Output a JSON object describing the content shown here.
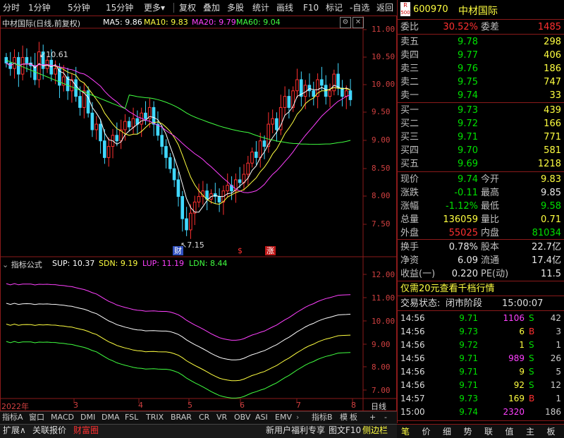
{
  "toolbar": {
    "left_items": [
      "分时",
      "1分钟",
      "5分钟",
      "15分钟",
      "更多"
    ],
    "right_items": [
      "复权",
      "叠加",
      "多股",
      "统计",
      "画线",
      "F10",
      "标记",
      "-自选",
      "返回"
    ]
  },
  "main_chart": {
    "title": "中材国际(日线,前复权)",
    "ma": [
      {
        "label": "MA5: 9.86",
        "color": "#ffffff"
      },
      {
        "label": "MA10: 9.83",
        "color": "#ffff40"
      },
      {
        "label": "MA20: 9.79",
        "color": "#ff40ff"
      },
      {
        "label": "MA60: 9.04",
        "color": "#40ff40"
      }
    ],
    "y_ticks": [
      "11.00",
      "10.50",
      "10.00",
      "9.50",
      "9.00",
      "8.50",
      "8.00",
      "7.50"
    ],
    "high_mark": "10.61",
    "low_mark": "7.15",
    "event_tags": [
      "财",
      "$",
      "涨"
    ]
  },
  "indicator_chart": {
    "name": "指标公式",
    "legend": [
      {
        "label": "SUP: 10.37",
        "color": "#ffffff"
      },
      {
        "label": "SDN: 9.19",
        "color": "#ffff40"
      },
      {
        "label": "LUP: 11.19",
        "color": "#ff40ff"
      },
      {
        "label": "LDN: 8.44",
        "color": "#40ff40"
      }
    ],
    "y_ticks": [
      "12.00",
      "11.00",
      "10.00",
      "9.00",
      "8.00",
      "7.00"
    ]
  },
  "x_axis": {
    "labels": [
      "2022年",
      "3",
      "4",
      "5",
      "6",
      "7",
      "8"
    ],
    "period": "日线"
  },
  "indicator_tabs": [
    "指标A",
    "窗口",
    "MACD",
    "DMI",
    "DMA",
    "FSL",
    "TRIX",
    "BRAR",
    "CR",
    "VR",
    "OBV",
    "ASI",
    "EMV"
  ],
  "indicator_tabs_right": [
    "指标B",
    "模",
    "板",
    "+",
    "-"
  ],
  "status_tabs": [
    "扩展∧",
    "关联报价",
    "财富圈"
  ],
  "status_links": [
    "新用户福利专享",
    "图文F10",
    "侧边栏"
  ],
  "quote": {
    "code": "600970",
    "name": "中材国际",
    "badge_top": "R",
    "badge_bottom": "500",
    "weibi_label": "委比",
    "weibi": "30.52%",
    "weicha_label": "委差",
    "weicha": "1485",
    "asks": [
      {
        "label": "卖五",
        "price": "9.78",
        "vol": "298"
      },
      {
        "label": "卖四",
        "price": "9.77",
        "vol": "406"
      },
      {
        "label": "卖三",
        "price": "9.76",
        "vol": "186"
      },
      {
        "label": "卖二",
        "price": "9.75",
        "vol": "747"
      },
      {
        "label": "卖一",
        "price": "9.74",
        "vol": "33"
      }
    ],
    "bids": [
      {
        "label": "买一",
        "price": "9.73",
        "vol": "439"
      },
      {
        "label": "买二",
        "price": "9.72",
        "vol": "166"
      },
      {
        "label": "买三",
        "price": "9.71",
        "vol": "771"
      },
      {
        "label": "买四",
        "price": "9.70",
        "vol": "581"
      },
      {
        "label": "买五",
        "price": "9.69",
        "vol": "1218"
      }
    ],
    "stats": [
      {
        "l1": "现价",
        "v1": "9.74",
        "c1": "green",
        "l2": "今开",
        "v2": "9.83",
        "c2": "yellow"
      },
      {
        "l1": "涨跌",
        "v1": "-0.11",
        "c1": "green",
        "l2": "最高",
        "v2": "9.85",
        "c2": "white"
      },
      {
        "l1": "涨幅",
        "v1": "-1.12%",
        "c1": "green",
        "l2": "最低",
        "v2": "9.58",
        "c2": "green"
      },
      {
        "l1": "总量",
        "v1": "136059",
        "c1": "yellow",
        "l2": "量比",
        "v2": "0.71",
        "c2": "yellow"
      },
      {
        "l1": "外盘",
        "v1": "55025",
        "c1": "red",
        "l2": "内盘",
        "v2": "81034",
        "c2": "green"
      }
    ],
    "stats2": [
      {
        "l1": "换手",
        "v1": "0.78%",
        "l2": "股本",
        "v2": "22.7亿"
      },
      {
        "l1": "净资",
        "v1": "6.09",
        "l2": "流通",
        "v2": "17.4亿"
      },
      {
        "l1": "收益(一)",
        "v1": "0.220",
        "l2": "PE(动)",
        "v2": "11.5"
      }
    ],
    "promo": "仅需20元查看千档行情",
    "trade_state_label": "交易状态:",
    "trade_state": "闭市阶段",
    "trade_time": "15:00:07",
    "ticks": [
      {
        "t": "14:56",
        "p": "9.71",
        "v": "1106",
        "s": "S",
        "n": "42",
        "vc": "magenta"
      },
      {
        "t": "14:56",
        "p": "9.73",
        "v": "6",
        "s": "B",
        "n": "3",
        "vc": "yellow"
      },
      {
        "t": "14:56",
        "p": "9.72",
        "v": "1",
        "s": "S",
        "n": "1",
        "vc": "yellow"
      },
      {
        "t": "14:56",
        "p": "9.71",
        "v": "989",
        "s": "S",
        "n": "26",
        "vc": "magenta"
      },
      {
        "t": "14:56",
        "p": "9.71",
        "v": "9",
        "s": "S",
        "n": "5",
        "vc": "yellow"
      },
      {
        "t": "14:56",
        "p": "9.71",
        "v": "92",
        "s": "S",
        "n": "12",
        "vc": "yellow"
      },
      {
        "t": "14:57",
        "p": "9.73",
        "v": "169",
        "s": "B",
        "n": "1",
        "vc": "yellow"
      },
      {
        "t": "15:00",
        "p": "9.74",
        "v": "2320",
        "s": "",
        "n": "186",
        "vc": "magenta"
      }
    ],
    "bottom_icons": [
      "笔",
      "价",
      "细",
      "势",
      "联",
      "值",
      "主",
      "板"
    ]
  }
}
